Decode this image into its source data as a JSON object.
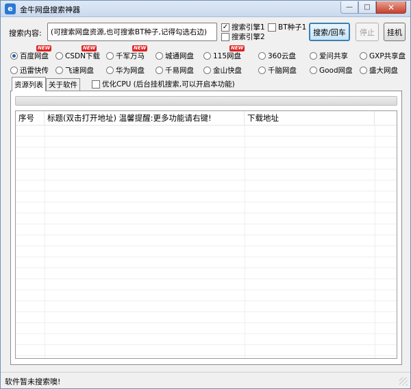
{
  "window": {
    "title": "金牛网盘搜索神器",
    "app_icon": "e"
  },
  "search": {
    "label": "搜索内容:",
    "value": "(可搜索网盘资源,也可搜索BT种子,记得勾选右边)"
  },
  "options": {
    "engine1": {
      "label": "搜索引擎1",
      "checked": true
    },
    "engine2": {
      "label": "搜索引擎2",
      "checked": false
    },
    "bt_seed": {
      "label": "BT种子1",
      "checked": false
    }
  },
  "buttons": {
    "search": "搜索/回车",
    "stop": "停止",
    "hangup": "挂机"
  },
  "sources": [
    {
      "label": "百度网盘",
      "selected": true,
      "new": true
    },
    {
      "label": "CSDN下载",
      "selected": false,
      "new": true
    },
    {
      "label": "千军万马",
      "selected": false,
      "new": true
    },
    {
      "label": "城通网盘",
      "selected": false,
      "new": false
    },
    {
      "label": "115网盘",
      "selected": false,
      "new": true
    },
    {
      "label": "360云盘",
      "selected": false,
      "new": false
    },
    {
      "label": "爱问共享",
      "selected": false,
      "new": false
    },
    {
      "label": "GXP共享盘",
      "selected": false,
      "new": false
    },
    {
      "label": "迅雷快传",
      "selected": false,
      "new": false
    },
    {
      "label": "飞速网盘",
      "selected": false,
      "new": false
    },
    {
      "label": "华为网盘",
      "selected": false,
      "new": false
    },
    {
      "label": "千易网盘",
      "selected": false,
      "new": false
    },
    {
      "label": "金山快盘",
      "selected": false,
      "new": false
    },
    {
      "label": "千脑网盘",
      "selected": false,
      "new": false
    },
    {
      "label": "Good网盘",
      "selected": false,
      "new": false
    },
    {
      "label": "盛大网盘",
      "selected": false,
      "new": false
    }
  ],
  "new_badge": "NEW",
  "tabs": [
    {
      "label": "资源列表",
      "active": true
    },
    {
      "label": "关于软件",
      "active": false
    }
  ],
  "optimize_cpu": {
    "label": "优化CPU (后台挂机搜索,可以开启本功能)",
    "checked": false
  },
  "table": {
    "columns": [
      "序号",
      "标题(双击打开地址) 温馨提醒:更多功能请右键!",
      "下载地址"
    ],
    "rows": []
  },
  "status": {
    "text": "软件暂未搜索噢!"
  },
  "colors": {
    "accent": "#3c7fb1",
    "badge": "#e02020",
    "titlebar": "#c9d9ee"
  }
}
